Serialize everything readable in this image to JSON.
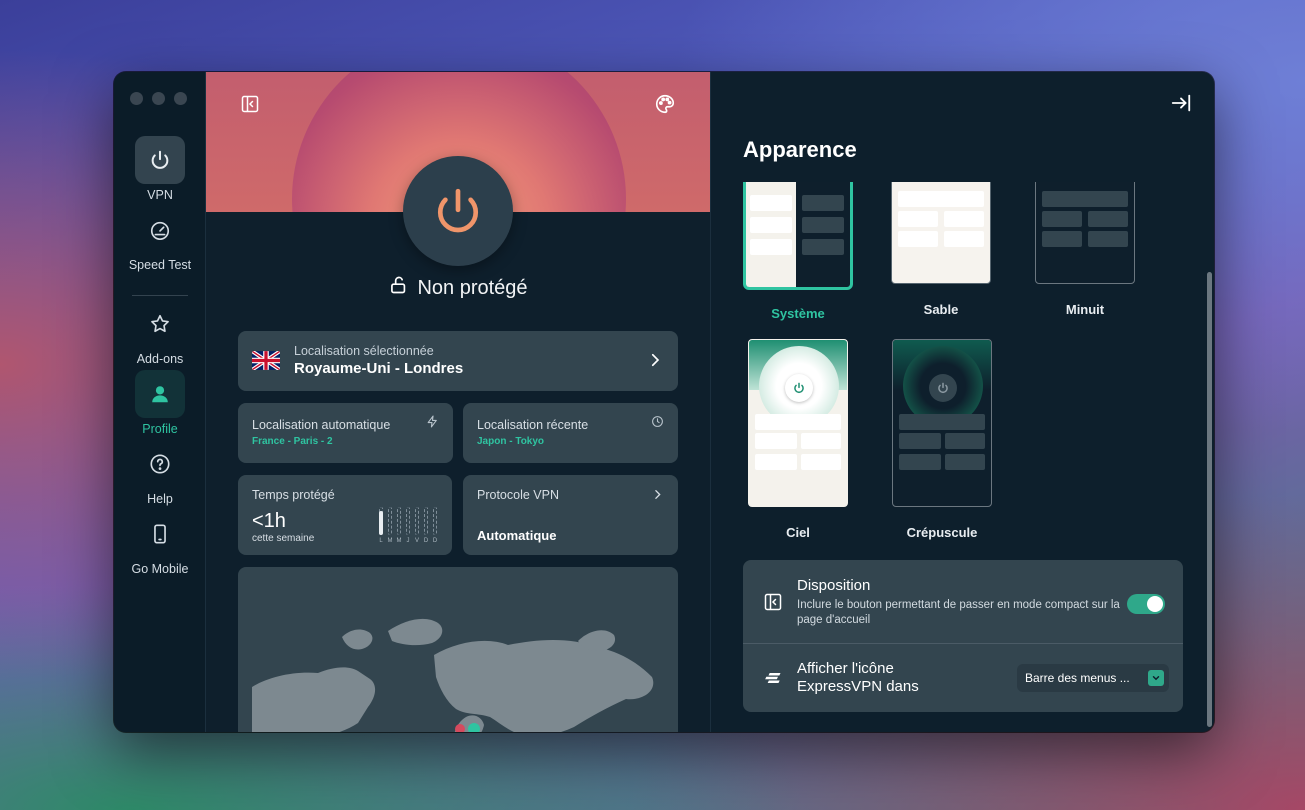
{
  "sidebar": {
    "items": [
      {
        "label": "VPN",
        "icon": "power-icon"
      },
      {
        "label": "Speed Test",
        "icon": "speedometer-icon"
      },
      {
        "label": "Add-ons",
        "icon": "star-icon"
      },
      {
        "label": "Profile",
        "icon": "person-icon"
      },
      {
        "label": "Help",
        "icon": "question-icon"
      },
      {
        "label": "Go Mobile",
        "icon": "phone-icon"
      }
    ]
  },
  "main": {
    "status": "Non protégé",
    "selected_location": {
      "label": "Localisation sélectionnée",
      "value": "Royaume-Uni - Londres",
      "flag": "uk-flag"
    },
    "auto_location": {
      "label": "Localisation automatique",
      "value": "France - Paris - 2"
    },
    "recent_location": {
      "label": "Localisation récente",
      "value": "Japon - Tokyo"
    },
    "protected_time": {
      "label": "Temps protégé",
      "value": "<1h",
      "sub": "cette semaine",
      "days": [
        "L",
        "M",
        "M",
        "J",
        "V",
        "D",
        "D"
      ],
      "levels": [
        0.85,
        0,
        0,
        0,
        0,
        0,
        0
      ]
    },
    "protocol": {
      "label": "Protocole VPN",
      "value": "Automatique"
    }
  },
  "right": {
    "title": "Apparence",
    "themes": [
      {
        "label": "Système",
        "selected": true
      },
      {
        "label": "Sable",
        "selected": false
      },
      {
        "label": "Minuit",
        "selected": false
      },
      {
        "label": "Ciel",
        "selected": false
      },
      {
        "label": "Crépuscule",
        "selected": false
      }
    ],
    "layout_setting": {
      "title": "Disposition",
      "description": "Inclure le bouton permettant de passer en mode compact sur la page d'accueil",
      "enabled": true
    },
    "icon_setting": {
      "title": "Afficher l'icône ExpressVPN dans",
      "value": "Barre des menus ..."
    }
  },
  "colors": {
    "accent": "#2fc4a1",
    "power": "#f0956a",
    "card": "#33454f"
  }
}
